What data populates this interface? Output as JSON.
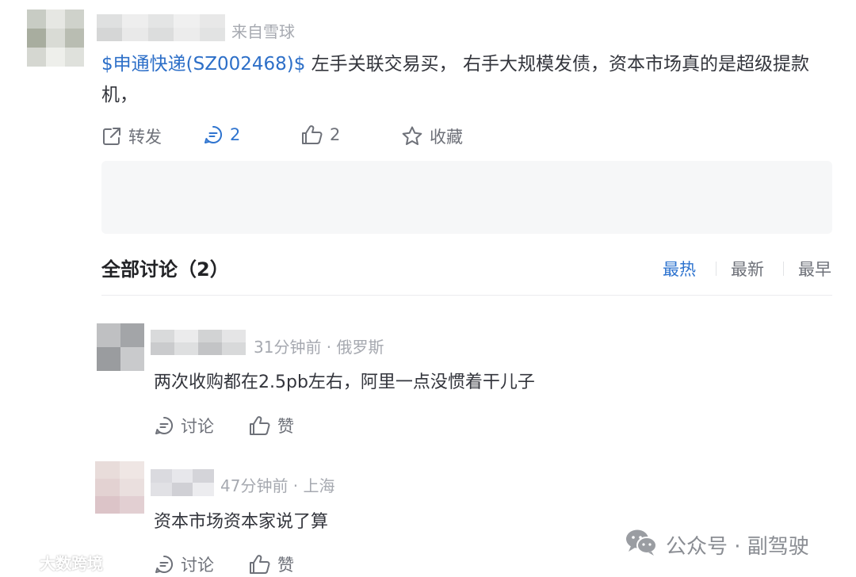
{
  "post": {
    "source": "来自雪球",
    "stock_link": "$申通快递(SZ002468)$",
    "text_line1": " 左手关联交易买， 右手大规模发债，资本市场真的是超级提款",
    "text_line2": "机，",
    "actions": {
      "repost": "转发",
      "comment_count": "2",
      "like_count": "2",
      "favorite": "收藏"
    }
  },
  "discussion": {
    "title": "全部讨论（2）",
    "sort_tabs": [
      "最热",
      "最新",
      "最早"
    ],
    "comments": [
      {
        "meta": "31分钟前 · 俄罗斯",
        "text": "两次收购都在2.5pb左右，阿里一点没惯着干儿子",
        "discuss_label": "讨论",
        "like_label": "赞"
      },
      {
        "meta": "47分钟前 · 上海",
        "text": "资本市场资本家说了算",
        "discuss_label": "讨论",
        "like_label": "赞"
      }
    ]
  },
  "watermarks": {
    "left": "大数跨境",
    "right": "公众号 · 副驾驶"
  },
  "colors": {
    "accent": "#2f74cf",
    "stock_link": "#2d6fc8",
    "meta_gray": "#a6a9b0",
    "text": "#33353c"
  },
  "icons": [
    "repost-icon",
    "comment-icon",
    "like-icon",
    "star-icon",
    "wechat-icon",
    "watermark-logo-icon"
  ]
}
